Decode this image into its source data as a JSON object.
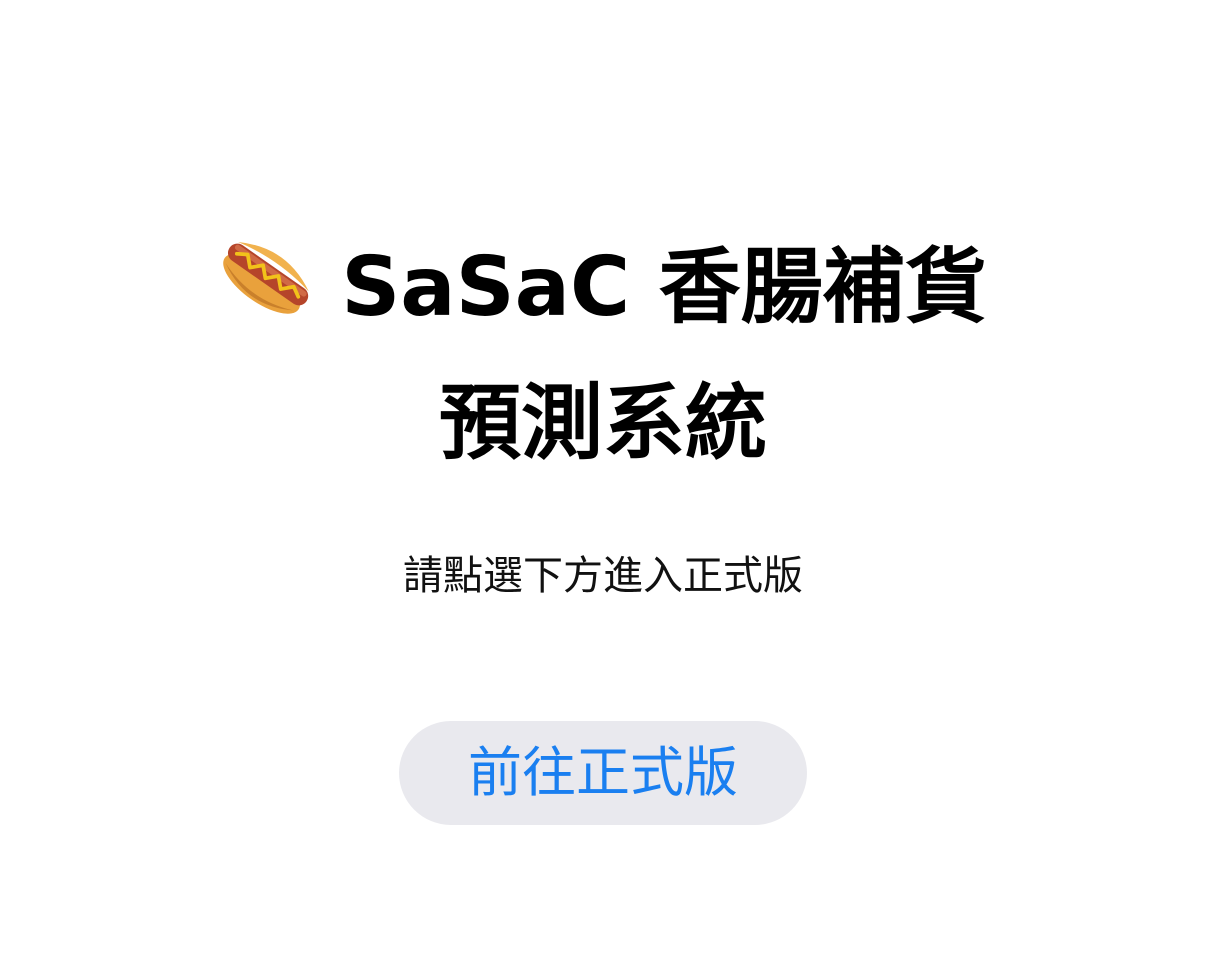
{
  "header": {
    "icon": "hotdog-icon",
    "title_line1": "SaSaC 香腸補貨",
    "title_line2": "預測系統"
  },
  "main": {
    "instruction": "請點選下方進入正式版",
    "button_label": "前往正式版"
  },
  "colors": {
    "background": "#ffffff",
    "title": "#000000",
    "button_bg": "#e9e9ee",
    "button_text": "#1a7ff0"
  }
}
